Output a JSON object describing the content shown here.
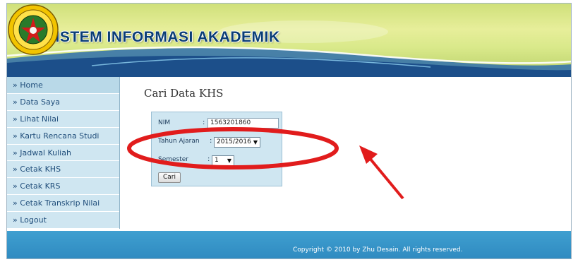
{
  "header": {
    "title": "SISTEM INFORMASI AKADEMIK"
  },
  "sidebar": {
    "items": [
      {
        "label": "» Home"
      },
      {
        "label": "» Data Saya"
      },
      {
        "label": "» Lihat Nilai"
      },
      {
        "label": "» Kartu Rencana Studi"
      },
      {
        "label": "» Jadwal Kuliah"
      },
      {
        "label": "» Cetak KHS"
      },
      {
        "label": "» Cetak KRS"
      },
      {
        "label": "» Cetak Transkrip Nilai"
      },
      {
        "label": "» Logout"
      }
    ]
  },
  "main": {
    "title": "Cari Data KHS",
    "form": {
      "nim_label": "NIM",
      "nim_value": "1563201860",
      "tahun_label": "Tahun Ajaran",
      "tahun_value": "2015/2016",
      "semester_label": "Semester",
      "semester_value": "1",
      "colon": ":",
      "submit_label": "Cari"
    }
  },
  "footer": {
    "copyright": "Copyright © 2010 by Zhu Desain. All rights reserved."
  },
  "colors": {
    "banner": "#d9e98a",
    "sidebar": "#cfe6f1",
    "footer": "#3f9fd0",
    "annotation": "#e11c1c",
    "title_text": "#0a3d75"
  },
  "icons": {
    "seal": "university-seal-logo",
    "dropdown": "dropdown-arrow-icon"
  }
}
